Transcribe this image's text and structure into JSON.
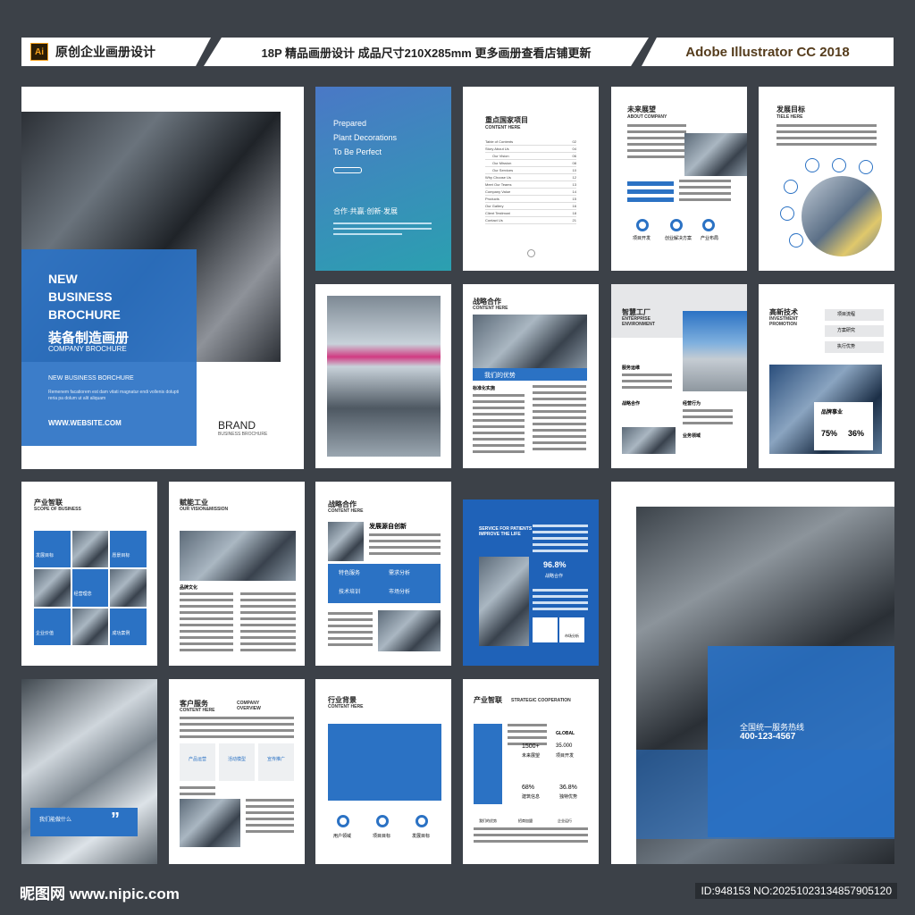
{
  "header": {
    "ai_badge": "Ai",
    "left_title": "原创企业画册设计",
    "center_text": "18P 精品画册设计  成品尺寸210X285mm  更多画册查看店铺更新",
    "right_text": "Adobe Illustrator CC 2018"
  },
  "cover": {
    "title_lines": [
      "NEW",
      "BUSINESS",
      "BROCHURE"
    ],
    "cn_title": "装备制造画册",
    "en_subtitle": "COMPANY BROCHURE",
    "small_title": "NEW BUSINESS BORCHURE",
    "body": "Remenem facatiorem est dam vitati magnatur endi vollenis dolupti reria pa dolum ut alit aliquam",
    "website": "WWW.WEBSITE.COM",
    "brand": "BRAND",
    "brand_sub": "BUSINESS BROCHURE"
  },
  "p2": {
    "line1": "Prepared",
    "line2": "Plant Decorations",
    "line3": "To Be Perfect",
    "cn": "合作·共赢·创新·发展"
  },
  "p3": {
    "title": "重点国家项目",
    "sub": "CONTENT HERE",
    "toc": [
      "Table of Contents",
      "Story About Us",
      "Our Vision",
      "Our Mission",
      "Our Services",
      "Why Choose Us",
      "Meet Our Teams",
      "Company Value",
      "Products",
      "Our Gallery",
      "Client Testimoni",
      "Contact Us"
    ],
    "nums": [
      "02",
      "04",
      "06",
      "08",
      "10",
      "12",
      "13",
      "14",
      "15",
      "16",
      "18",
      "21"
    ]
  },
  "p4": {
    "title": "未来展望",
    "sub": "ABOUT COMPANY",
    "r1": "项目开发",
    "r2": "创业解决方案",
    "r3": "产业布局"
  },
  "p5": {
    "title": "发展目标",
    "sub": "TIELE HERE"
  },
  "p7": {
    "title": "战略合作",
    "sub": "CONTENT HERE",
    "banner": "我们的优势",
    "label": "标准化实施"
  },
  "p8": {
    "title": "智慧工厂",
    "sub": "ENTERPRISE ENVIRONMENT",
    "a": "服务运维",
    "b": "战略合作",
    "c": "经营行为",
    "d": "业务领域"
  },
  "p9": {
    "title": "高新技术",
    "sub": "INVESTMENT PROMOTION",
    "i1": "项目流程",
    "i2": "方案研究",
    "i3": "执行优势",
    "s1": "75%",
    "s2": "36%",
    "box": "品牌事业"
  },
  "p10": {
    "title": "产业智联",
    "sub": "SCOPE OF BUSINESS",
    "c1": "发展目标",
    "c2": "愿景目标",
    "c3": "经营理念",
    "c4": "企业价值",
    "c5": "成功案例"
  },
  "p11": {
    "title": "赋能工业",
    "sub": "OUR VISION&MISSION",
    "label": "品牌文化"
  },
  "p12": {
    "title": "战略合作",
    "sub": "CONTENT HERE",
    "head": "发展源自创新",
    "b1": "特色服务",
    "b2": "需求分析",
    "b3": "技术培训",
    "b4": "市场分析"
  },
  "p13": {
    "side": "SERVICE FOR PATIENTS IMPROVE THE LIFE",
    "stat": "96.8%",
    "stat_label": "战略合作",
    "tag": "市场分析"
  },
  "p15": {
    "title": "我们能做什么"
  },
  "p16": {
    "title": "客户服务",
    "sub": "CONTENT HERE",
    "title2": "COMPANY OVERVIEW",
    "c1": "产品运营",
    "c2": "活动模型",
    "c3": "宣传推广"
  },
  "p17": {
    "title": "行业背景",
    "sub": "CONTENT HERE",
    "r1": "用户领域",
    "r2": "项目目标",
    "r3": "发展目标"
  },
  "p18": {
    "title": "产业智联",
    "sub": "STRATEGIC COOPERATION",
    "v1": "1500+",
    "l1": "未来展望",
    "v2": "GLOBAL",
    "l2": "35.000",
    "l2b": "项目开发",
    "v3": "68%",
    "l3": "建筑信息",
    "v4": "36.8%",
    "l4": "独特优势",
    "b1": "我们的优势",
    "b2": "招商加盟",
    "b3": "企业运行"
  },
  "back": {
    "hotline": "全国统一服务热线",
    "phone": "400-123-4567"
  },
  "footer": {
    "logo": "昵图网 www.nipic.com",
    "id": "ID:948153 NO:20251023134857905120"
  },
  "colors": {
    "accent": "#2b72c4",
    "dark_bg": "#3c4148"
  }
}
